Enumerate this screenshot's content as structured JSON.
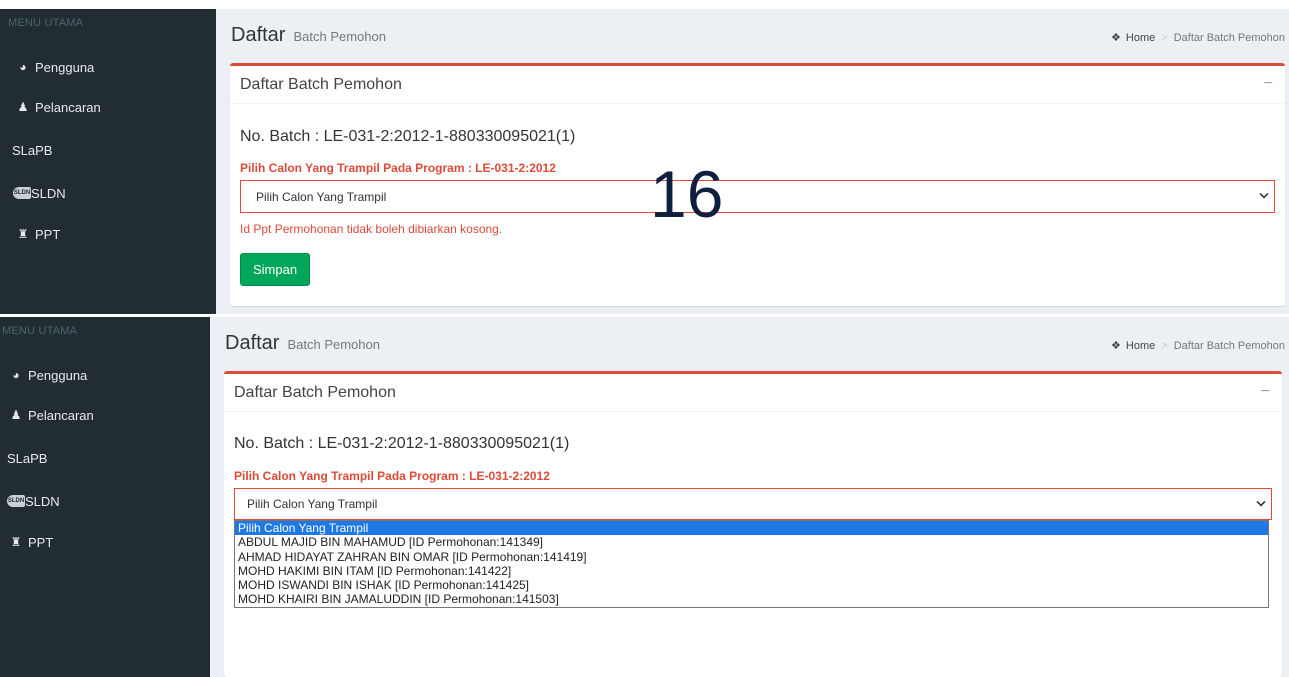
{
  "sidebar": {
    "header": "MENU UTAMA",
    "items": [
      {
        "label": "Pengguna",
        "icon": "pie-chart-icon"
      },
      {
        "label": "Pelancaran",
        "icon": "user-icon"
      },
      {
        "label": "SLaPB",
        "icon": ""
      },
      {
        "label": "SLDN",
        "icon": "sldn-logo-icon"
      },
      {
        "label": "PPT",
        "icon": "bank-icon"
      }
    ]
  },
  "page": {
    "title": "Daftar",
    "subtitle": "Batch Pemohon"
  },
  "breadcrumb": {
    "home": "Home",
    "current": "Daftar Batch Pemohon"
  },
  "box": {
    "title": "Daftar Batch Pemohon",
    "collapse_symbol": "−"
  },
  "form": {
    "batch_no": "No. Batch : LE-031-2:2012-1-880330095021(1)",
    "program_label": "Pilih Calon Yang Trampil Pada Program : LE-031-2:2012",
    "select_value": "Pilih Calon Yang Trampil",
    "error_message": "Id Ppt Permohonan tidak boleh dibiarkan kosong.",
    "save_label": "Simpan"
  },
  "dropdown_options": [
    "Pilih Calon Yang Trampil",
    "ABDUL MAJID BIN MAHAMUD [ID Permohonan:141349]",
    "AHMAD HIDAYAT ZAHRAN BIN OMAR [ID Permohonan:141419]",
    "MOHD HAKIMI BIN ITAM [ID Permohonan:141422]",
    "MOHD ISWANDI BIN ISHAK [ID Permohonan:141425]",
    "MOHD KHAIRI BIN JAMALUDDIN [ID Permohonan:141503]"
  ],
  "overlay_number": "16",
  "colors": {
    "sidebar_bg": "#222d32",
    "content_bg": "#ecf0f5",
    "accent_red": "#dd4b39",
    "button_green": "#00a65a",
    "dropdown_highlight": "#1e79e6"
  }
}
